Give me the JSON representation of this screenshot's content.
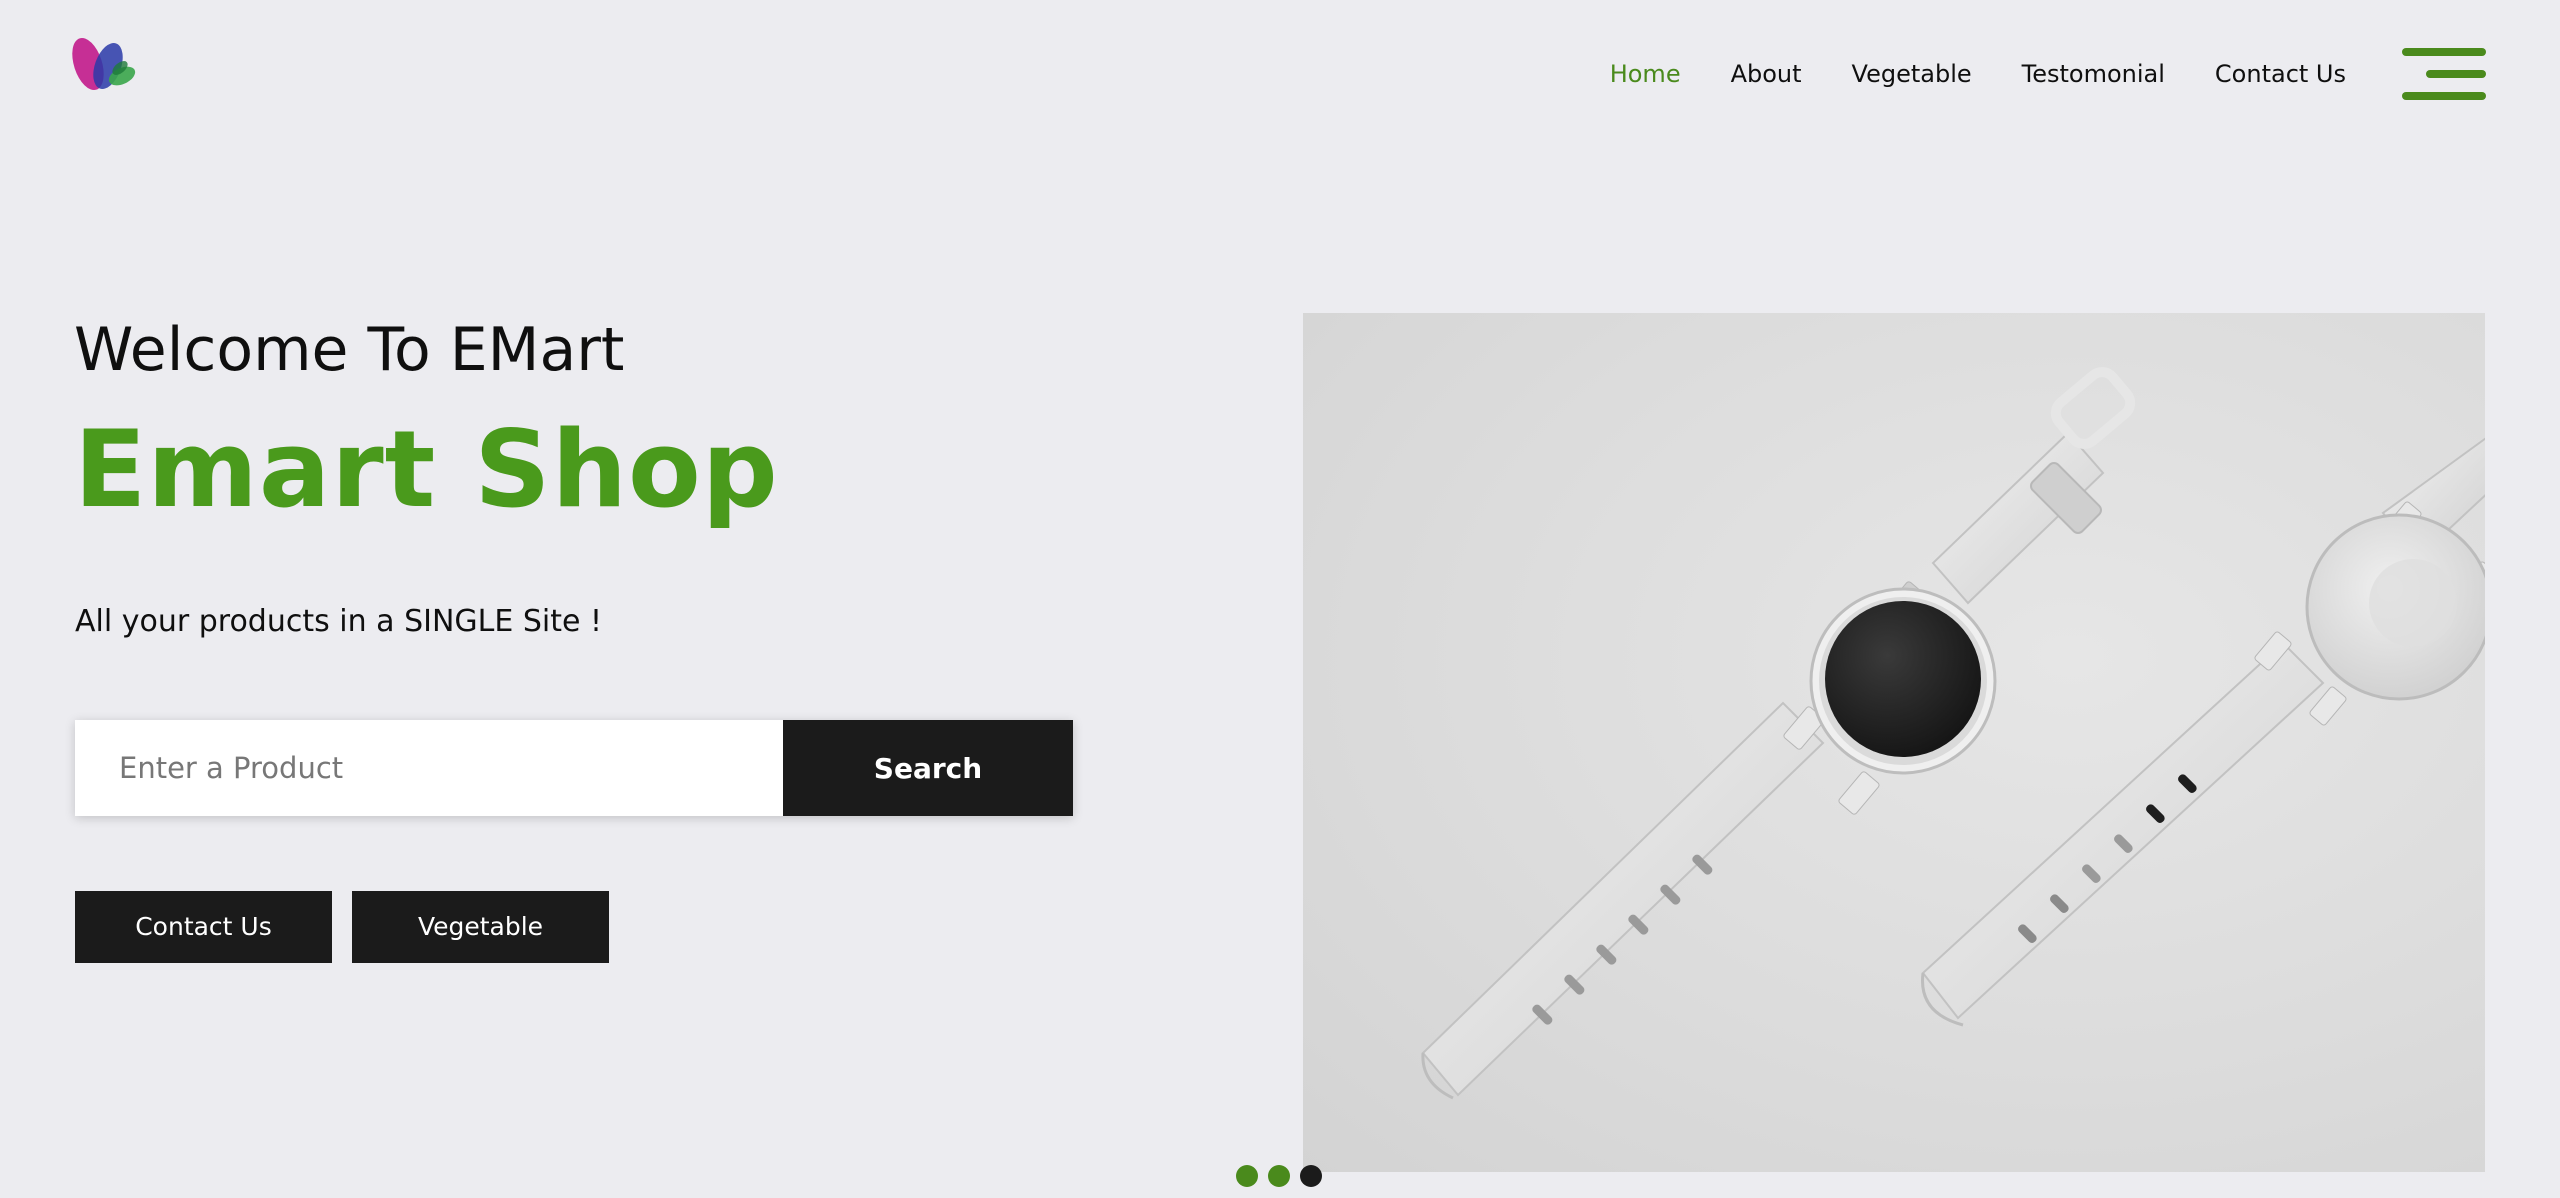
{
  "colors": {
    "accent": "#4a9a1c",
    "nav_active": "#4a8a1c",
    "dark_button": "#1b1b1b",
    "background": "#ececf0"
  },
  "nav": {
    "items": [
      {
        "label": "Home",
        "active": true
      },
      {
        "label": "About",
        "active": false
      },
      {
        "label": "Vegetable",
        "active": false
      },
      {
        "label": "Testomonial",
        "active": false
      },
      {
        "label": "Contact Us",
        "active": false
      }
    ],
    "menu_icon": "hamburger-menu-icon"
  },
  "logo": {
    "icon": "petal-logo-icon"
  },
  "hero": {
    "welcome": "Welcome To EMart",
    "brand": "Emart Shop",
    "tagline": "All your products in a SINGLE Site !",
    "search": {
      "placeholder": "Enter a Product",
      "value": "",
      "button_label": "Search"
    },
    "buttons": {
      "contact": "Contact Us",
      "vegetable": "Vegetable"
    },
    "image": "smartwatch-product-image"
  },
  "carousel": {
    "dots": [
      {
        "color": "#4a8a1c",
        "active": false
      },
      {
        "color": "#4a8a1c",
        "active": false
      },
      {
        "color": "#1b1b1b",
        "active": true
      }
    ]
  }
}
